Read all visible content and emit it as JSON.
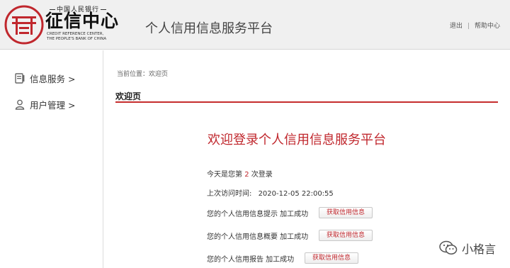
{
  "header": {
    "logo_top": "中国人民银行",
    "logo_main": "征信中心",
    "logo_sub_line1": "CREDIT REFERENCE CENTER,",
    "logo_sub_line2": "THE PEOPLE'S BANK OF CHINA",
    "site_title": "个人信用信息服务平台",
    "logout_label": "退出",
    "separator": "|",
    "help_label": "帮助中心"
  },
  "sidebar": {
    "items": [
      {
        "label": "信息服务 >",
        "icon": "document-icon"
      },
      {
        "label": "用户管理 >",
        "icon": "user-icon"
      }
    ]
  },
  "main": {
    "breadcrumb": "当前位置：欢迎页",
    "section_title": "欢迎页",
    "welcome": "欢迎登录个人信用信息服务平台",
    "login_prefix": "今天是您第",
    "login_count": "2",
    "login_suffix": "次登录",
    "last_visit_label": "上次访问时间:",
    "last_visit_time": "2020-12-05 22:00:55",
    "rows": [
      {
        "text": "您的个人信用信息提示 加工成功",
        "button": "获取信用信息"
      },
      {
        "text": "您的个人信用信息概要 加工成功",
        "button": "获取信用信息"
      },
      {
        "text": "您的个人信用报告 加工成功",
        "button": "获取信用信息"
      }
    ]
  },
  "watermark": {
    "text": "小格言",
    "icon": "wechat-icon"
  },
  "colors": {
    "accent": "#c0272d",
    "rule": "#c62d2d",
    "header_bg": "#f0f0f0"
  }
}
